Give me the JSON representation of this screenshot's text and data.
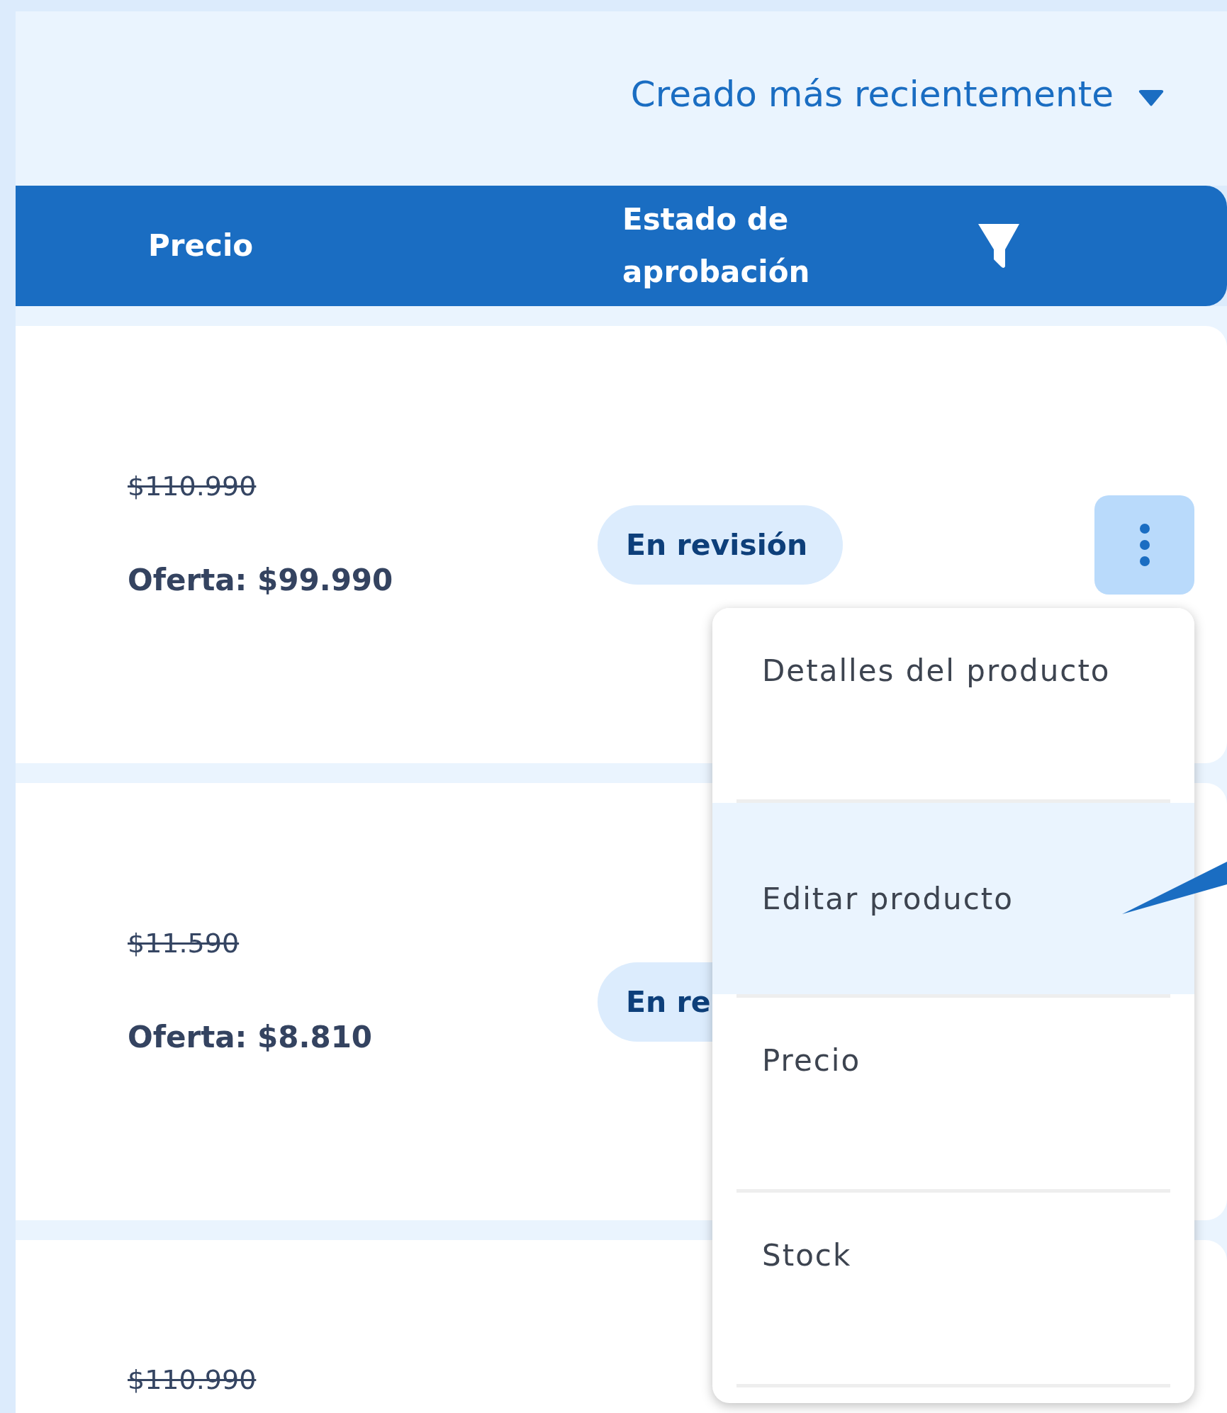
{
  "sort": {
    "label": "Creado más recientemente"
  },
  "table": {
    "columns": [
      {
        "label": "Precio",
        "filter": false
      },
      {
        "label": "Estado de aprobación",
        "filter": true
      }
    ],
    "rows": [
      {
        "price": "$110.990",
        "offer": "Oferta: $99.990",
        "status": "En revisión",
        "menu_open": true
      },
      {
        "price": "$11.590",
        "offer": "Oferta: $8.810",
        "status": "En re",
        "menu_open": false
      },
      {
        "price": "$110.990",
        "menu_open": false
      }
    ]
  },
  "action_menu": {
    "items": [
      {
        "label": "Detalles del producto",
        "selected": false
      },
      {
        "label": "Editar producto",
        "selected": true
      },
      {
        "label": "Precio",
        "selected": false
      },
      {
        "label": "Stock",
        "selected": false
      }
    ]
  }
}
